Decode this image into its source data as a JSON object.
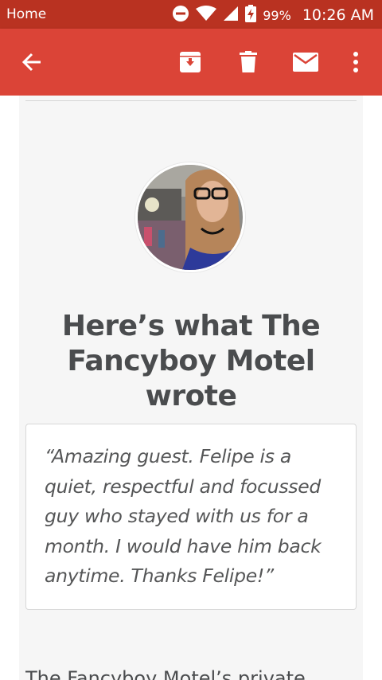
{
  "status_bar": {
    "label": "Home",
    "battery_percent": "99%",
    "time": "10:26 AM"
  },
  "toolbar": {
    "icons": [
      "back-arrow-icon",
      "archive-icon",
      "trash-icon",
      "mail-icon",
      "more-vert-icon"
    ]
  },
  "review": {
    "heading": "Here’s what The Fancyboy Motel wrote",
    "quote": "“Amazing guest. Felipe is a quiet, respectful and focussed guy who stayed with us for a month. I would have him back anytime. Thanks Felipe!”",
    "next_paragraph": "The Fancyboy Motel’s private"
  },
  "colors": {
    "status_bar": "#b93221",
    "toolbar": "#db4437",
    "card_bg": "#f6f6f6",
    "heading_text": "#4a4c4e"
  }
}
